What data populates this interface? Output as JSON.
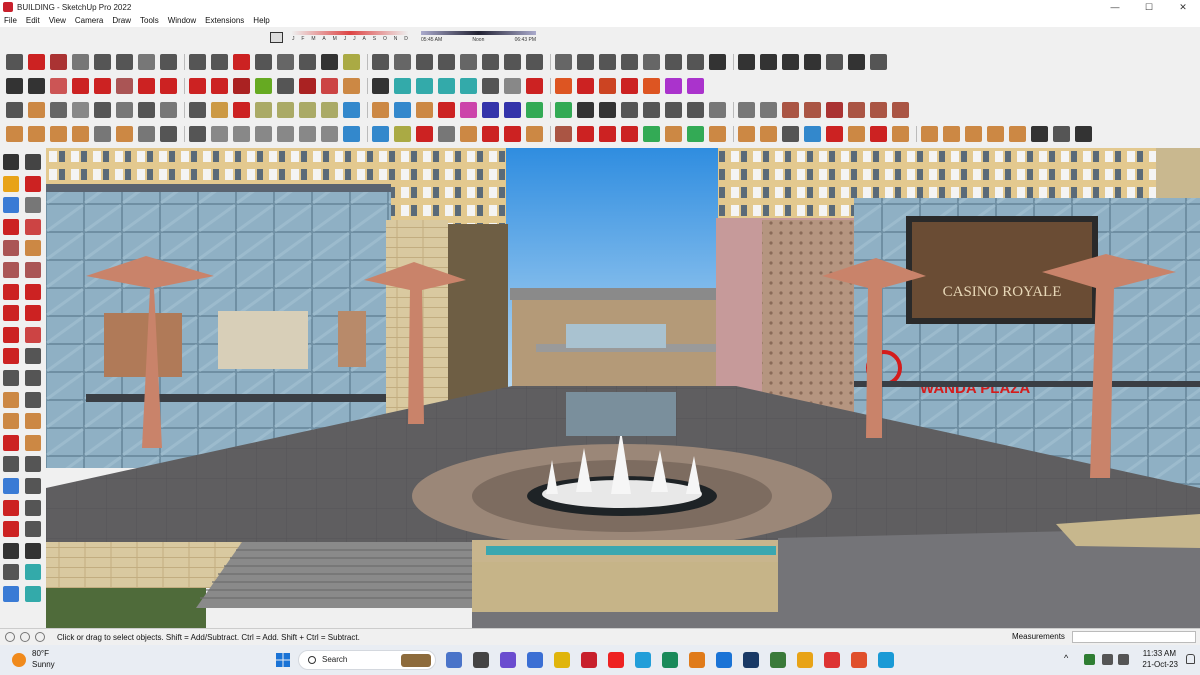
{
  "window": {
    "title": "BUILDING - SketchUp Pro 2022",
    "controls": {
      "minimize": "—",
      "maximize": "☐",
      "close": "✕"
    }
  },
  "menu": [
    "File",
    "Edit",
    "View",
    "Camera",
    "Draw",
    "Tools",
    "Window",
    "Extensions",
    "Help"
  ],
  "shadow_settings": {
    "months": [
      "J",
      "F",
      "M",
      "A",
      "M",
      "J",
      "J",
      "A",
      "S",
      "O",
      "N",
      "D"
    ],
    "time_start": "05:45 AM",
    "time_noon": "Noon",
    "time_end": "06:43 PM"
  },
  "toolbar_colors": {
    "row1": [
      "#555",
      "#c22",
      "#a33",
      "#777",
      "#555",
      "#555",
      "#777",
      "#555",
      "#555",
      "#555",
      "#c22",
      "#555",
      "#666",
      "#555",
      "#333",
      "#aa4",
      "#555",
      "#666",
      "#555",
      "#555",
      "#666",
      "#555",
      "#555",
      "#555",
      "#666",
      "#555",
      "#555",
      "#555",
      "#666",
      "#555",
      "#555",
      "#333",
      "#333",
      "#333",
      "#333",
      "#333",
      "#555",
      "#333",
      "#555"
    ],
    "row2": [
      "#333",
      "#333",
      "#c55",
      "#c22",
      "#c22",
      "#a55",
      "#c22",
      "#c22",
      "#c22",
      "#c22",
      "#a22",
      "#6a2",
      "#555",
      "#a22",
      "#c44",
      "#c84",
      "#333",
      "#3aa",
      "#3aa",
      "#3aa",
      "#3aa",
      "#555",
      "#888",
      "#c22",
      "#d52",
      "#c22",
      "#c42",
      "#c22",
      "#d52",
      "#a3c",
      "#a3c"
    ],
    "row3": [
      "#555",
      "#c84",
      "#666",
      "#888",
      "#555",
      "#777",
      "#555",
      "#777",
      "#555",
      "#c94",
      "#c22",
      "#aa6",
      "#aa6",
      "#aa6",
      "#aa6",
      "#38c",
      "#c84",
      "#38c",
      "#c84",
      "#c22",
      "#c4a",
      "#33a",
      "#33a",
      "#3a5",
      "#3a5",
      "#333",
      "#333",
      "#555",
      "#555",
      "#555",
      "#555",
      "#777",
      "#777",
      "#777",
      "#a54",
      "#a54",
      "#a33",
      "#a54",
      "#a54",
      "#a54"
    ],
    "row4": [
      "#c84",
      "#c84",
      "#c84",
      "#c84",
      "#777",
      "#c84",
      "#777",
      "#555",
      "#555",
      "#888",
      "#888",
      "#888",
      "#888",
      "#888",
      "#888",
      "#38c",
      "#38c",
      "#aa4",
      "#c22",
      "#777",
      "#c84",
      "#c22",
      "#c22",
      "#c84",
      "#a54",
      "#c22",
      "#c22",
      "#c22",
      "#3a5",
      "#c84",
      "#3a5",
      "#c84",
      "#c84",
      "#c84",
      "#555",
      "#38c",
      "#c22",
      "#c84",
      "#c22",
      "#c84",
      "#c84",
      "#c84",
      "#c84",
      "#c84",
      "#c84",
      "#333",
      "#555",
      "#333"
    ]
  },
  "left_tools": [
    "#333",
    "#444",
    "#e8a317",
    "#c22",
    "#3a7bd5",
    "#777",
    "#c22",
    "#c44",
    "#a55",
    "#c84",
    "#a55",
    "#a55",
    "#c22",
    "#c22",
    "#c22",
    "#c22",
    "#c22",
    "#c44",
    "#c22",
    "#555",
    "#555",
    "#555",
    "#c84",
    "#555",
    "#c84",
    "#c84",
    "#c22",
    "#c84",
    "#555",
    "#555",
    "#3a7bd5",
    "#555",
    "#c22",
    "#555",
    "#c22",
    "#555",
    "#333",
    "#333",
    "#555",
    "#3aa",
    "#3a7bd5",
    "#3aa"
  ],
  "scene": {
    "sky_top": "#2f8de0",
    "sky_bottom": "#d8ecf8",
    "billboard_text": "CASINO ROYALE",
    "sign_text": "WANDA PLAZA",
    "sign_color": "#d41c1c"
  },
  "status": {
    "message": "Click or drag to select objects. Shift = Add/Subtract. Ctrl = Add. Shift + Ctrl = Subtract.",
    "measurements_label": "Measurements",
    "measurements_value": ""
  },
  "taskbar": {
    "weather_temp": "80°F",
    "weather_desc": "Sunny",
    "search_label": "Search",
    "apps": [
      "#4a74c9",
      "#444",
      "#6a4ccf",
      "#3b6fd4",
      "#e0b50c",
      "#c8202c",
      "#e22",
      "#229ed9",
      "#1a8a5a",
      "#e07b1a",
      "#1a73d6",
      "#1a3a66",
      "#3a7a3a",
      "#e8a317",
      "#d33",
      "#e0502c",
      "#1a9ad6"
    ],
    "tray_up": "^",
    "time": "11:33 AM",
    "date": "21-Oct-23"
  }
}
